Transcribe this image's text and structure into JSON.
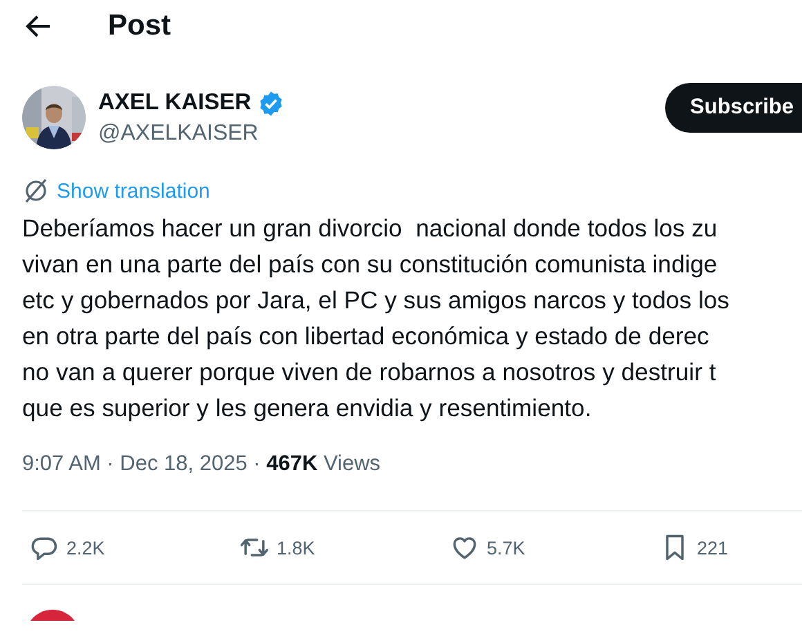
{
  "header": {
    "title": "Post"
  },
  "author": {
    "name": "AXEL KAISER",
    "handle": "@AXELKAISER",
    "verified": true
  },
  "subscribe_button": "Subscribe",
  "translation_link": "Show translation",
  "text_lines": [
    "Deberíamos hacer un gran divorcio  nacional donde todos los zu",
    "vivan en una parte del país con su constitución comunista indige",
    "etc y gobernados por Jara, el PC y sus amigos narcos y todos los",
    "en otra parte del país con libertad económica y estado de derec",
    "no van a querer porque viven de robarnos a nosotros y destruir t",
    "que es superior y les genera envidia y resentimiento."
  ],
  "meta": "9:07 AM · Dec 18, 2025 · **467K** Views",
  "actions": [
    {
      "kind": "reply",
      "count": "2.2K"
    },
    {
      "kind": "repost",
      "count": "1.8K"
    },
    {
      "kind": "like",
      "count": "5.7K"
    },
    {
      "kind": "bookmark",
      "count": "221"
    }
  ],
  "next_reply": {
    "color": "#d6243a"
  }
}
